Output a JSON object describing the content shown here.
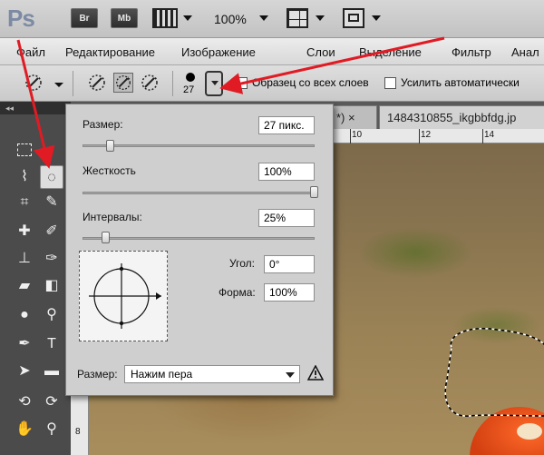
{
  "appbar": {
    "logo": "Ps",
    "bridge_btn": "Br",
    "minibridge_btn": "Mb",
    "zoom": "100%"
  },
  "menu": {
    "items": [
      "Файл",
      "Редактирование",
      "Изображение",
      "Слои",
      "Выделение",
      "Фильтр",
      "Анал"
    ]
  },
  "options": {
    "brush_size": "27",
    "sample_all_layers": "Образец со всех слоев",
    "auto_enhance": "Усилить автоматически"
  },
  "tools_panel": {
    "collapse_label": "◂◂"
  },
  "document": {
    "tab_partial": "*) × ",
    "tab_name": "1484310855_ikgbbfdg.jp",
    "ruler_top": [
      "10",
      "12",
      "14"
    ],
    "ruler_left": [
      "8"
    ]
  },
  "brush_popup": {
    "size_label": "Размер:",
    "size_value": "27 пикс.",
    "size_fraction": 0.12,
    "hardness_label": "Жесткость",
    "hardness_value": "100%",
    "hardness_fraction": 1.0,
    "spacing_label": "Интервалы:",
    "spacing_value": "25%",
    "spacing_fraction": 0.1,
    "angle_label": "Угол:",
    "angle_value": "0°",
    "roundness_label": "Форма:",
    "roundness_value": "100%",
    "pen_size_label": "Размер:",
    "pen_size_option": "Нажим пера"
  },
  "colors": {
    "annotation_arrow": "#e01b24",
    "canvas_grass": "#8a7550",
    "mushroom_cap": "#e04a18"
  }
}
